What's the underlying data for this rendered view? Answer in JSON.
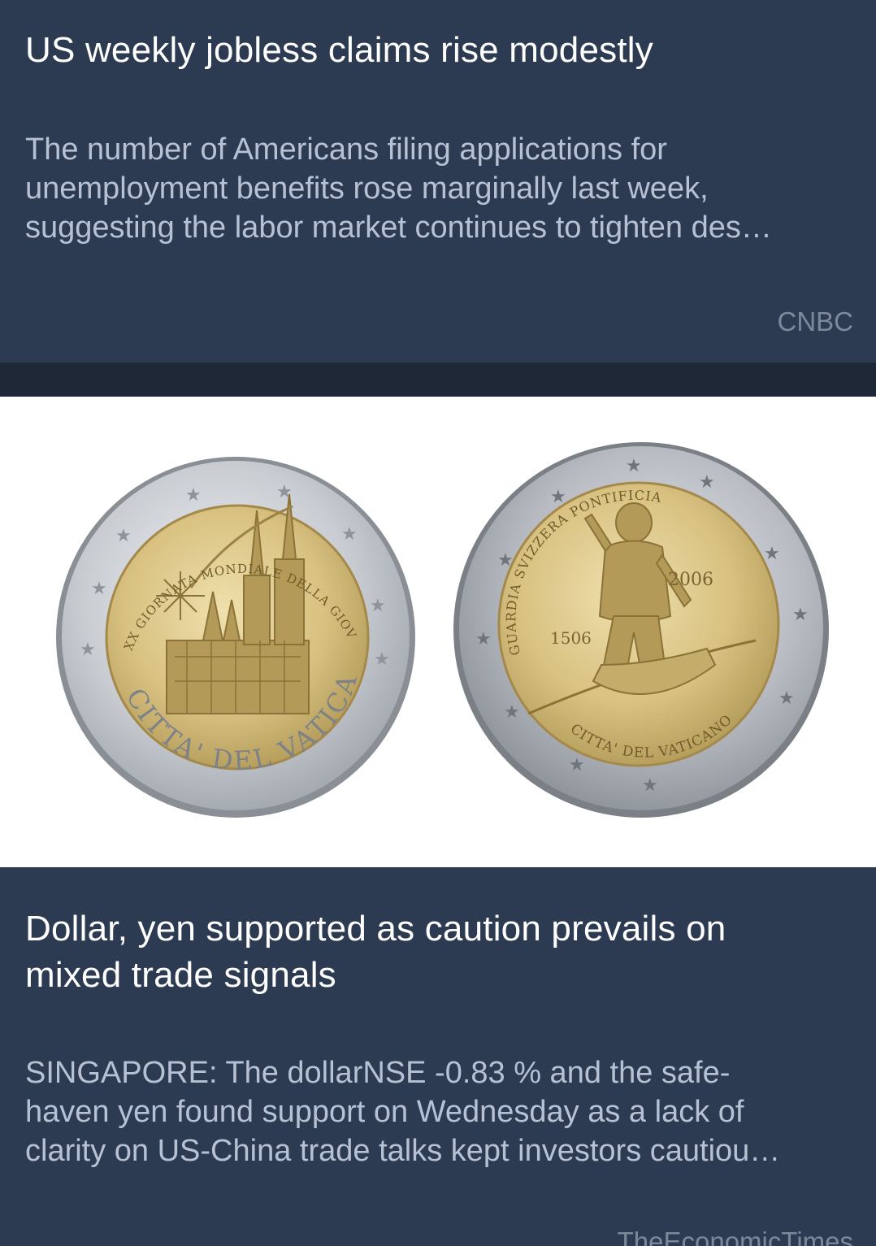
{
  "articles": [
    {
      "title": "US weekly jobless claims rise modestly",
      "summary_lines": [
        "The number of Americans filing applications for",
        "unemployment benefits rose marginally last week,",
        "suggesting the labor market continues to tighten des…"
      ],
      "source": "CNBC"
    },
    {
      "image": {
        "coin_left": {
          "inscriptions": [
            "CITTA' DEL VATICANO",
            "XX GIORNATA MONDIALE DELLA GIOVENTU'"
          ]
        },
        "coin_right": {
          "inscriptions": [
            "GUARDIA SVIZZERA PONTIFICIA",
            "CITTA' DEL VATICANO"
          ],
          "years": [
            "1506",
            "2006"
          ]
        }
      },
      "title_lines": [
        "Dollar, yen supported as caution prevails on",
        "mixed trade signals"
      ],
      "summary_lines": [
        "SINGAPORE: The dollarNSE -0.83 % and the safe-",
        "haven yen found support on Wednesday as a lack of",
        "clarity on US-China trade talks kept investors cautiou…"
      ],
      "source": "TheEconomicTimes"
    }
  ]
}
